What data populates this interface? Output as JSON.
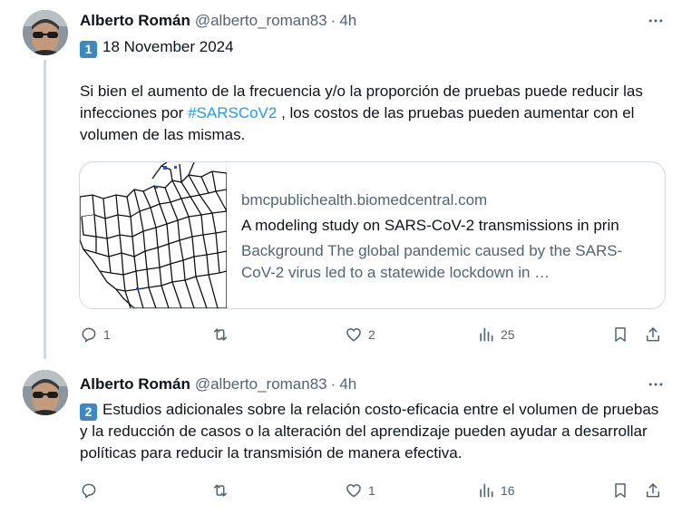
{
  "tweets": [
    {
      "author_name": "Alberto Román",
      "handle": "@alberto_roman83",
      "separator": "·",
      "time": "4h",
      "keycap": "1",
      "date_line": "18 November 2024",
      "text_before_tag": "Si bien el aumento de la frecuencia y/o la proporción de pruebas puede reducir las infecciones por ",
      "hashtag": "#SARSCoV2",
      "text_after_tag": " , los costos de las pruebas pueden aumentar con el volumen de las mismas.",
      "card": {
        "domain": "bmcpublichealth.biomedcentral.com",
        "title": "A modeling study on SARS-CoV-2 transmissions in prin",
        "description": "Background The global pandemic caused by the SARS-CoV-2 virus led to a statewide lockdown in …"
      },
      "replies": "1",
      "reposts": "",
      "likes": "2",
      "views": "25"
    },
    {
      "author_name": "Alberto Román",
      "handle": "@alberto_roman83",
      "separator": "·",
      "time": "4h",
      "keycap": "2",
      "text": "Estudios adicionales sobre la relación costo-eficacia entre el volumen de pruebas y la reducción de casos o la alteración del aprendizaje pueden ayudar a desarrollar políticas para reducir la transmisión de manera efectiva.",
      "replies": "",
      "reposts": "",
      "likes": "1",
      "views": "16"
    }
  ],
  "icons": {
    "more": "more-dots-icon",
    "reply": "reply-bubble-icon",
    "repost": "repost-arrows-icon",
    "like": "heart-icon",
    "views": "bar-chart-icon",
    "bookmark": "bookmark-icon",
    "share": "share-upload-icon"
  },
  "colors": {
    "text": "#0f1419",
    "secondary": "#536471",
    "link": "#1d9bf0",
    "border": "#cfd9de",
    "keycap": "#3b88c3"
  }
}
